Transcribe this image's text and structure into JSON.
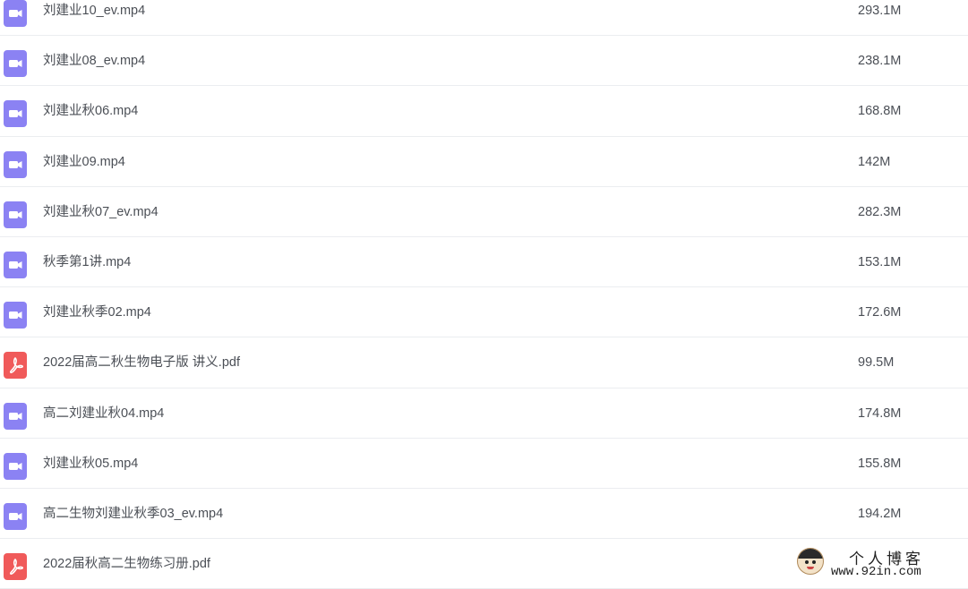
{
  "files": [
    {
      "name": "刘建业10_ev.mp4",
      "size": "293.1M",
      "type": "video",
      "icon": "video-file-icon"
    },
    {
      "name": "刘建业08_ev.mp4",
      "size": "238.1M",
      "type": "video",
      "icon": "video-file-icon"
    },
    {
      "name": "刘建业秋06.mp4",
      "size": "168.8M",
      "type": "video",
      "icon": "video-file-icon"
    },
    {
      "name": "刘建业09.mp4",
      "size": "142M",
      "type": "video",
      "icon": "video-file-icon"
    },
    {
      "name": "刘建业秋07_ev.mp4",
      "size": "282.3M",
      "type": "video",
      "icon": "video-file-icon"
    },
    {
      "name": "秋季第1讲.mp4",
      "size": "153.1M",
      "type": "video",
      "icon": "video-file-icon"
    },
    {
      "name": "刘建业秋季02.mp4",
      "size": "172.6M",
      "type": "video",
      "icon": "video-file-icon"
    },
    {
      "name": "2022届高二秋生物电子版 讲义.pdf",
      "size": "99.5M",
      "type": "pdf",
      "icon": "pdf-file-icon"
    },
    {
      "name": "高二刘建业秋04.mp4",
      "size": "174.8M",
      "type": "video",
      "icon": "video-file-icon"
    },
    {
      "name": "刘建业秋05.mp4",
      "size": "155.8M",
      "type": "video",
      "icon": "video-file-icon"
    },
    {
      "name": "高二生物刘建业秋季03_ev.mp4",
      "size": "194.2M",
      "type": "video",
      "icon": "video-file-icon"
    },
    {
      "name": "2022届秋高二生物练习册.pdf",
      "size": "",
      "type": "pdf",
      "icon": "pdf-file-icon"
    }
  ],
  "watermark": {
    "title": "个人博客",
    "url": "www.92in.com"
  },
  "colors": {
    "video_icon": "#8b82f3",
    "pdf_icon": "#f05a5a",
    "text": "#4b4f56",
    "divider": "#ebedf0"
  }
}
